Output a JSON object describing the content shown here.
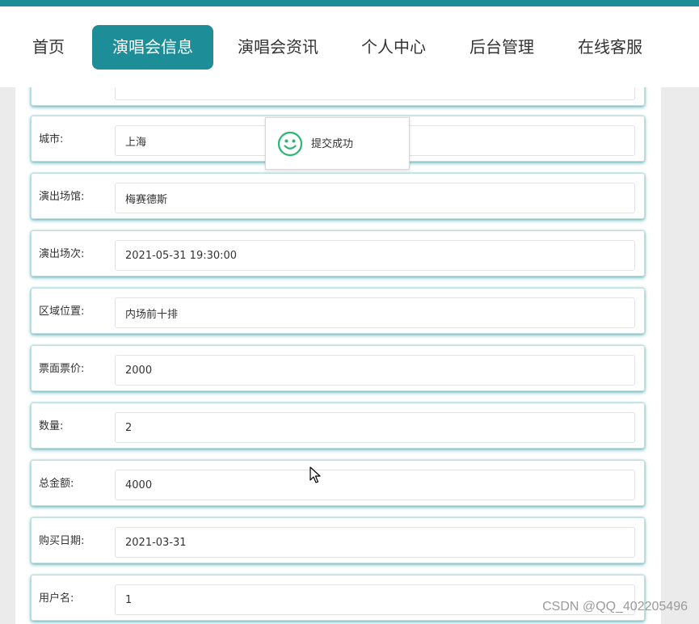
{
  "nav": {
    "items": [
      {
        "label": "首页"
      },
      {
        "label": "演唱会信息",
        "active": true
      },
      {
        "label": "演唱会资讯"
      },
      {
        "label": "个人中心"
      },
      {
        "label": "后台管理"
      },
      {
        "label": "在线客服"
      }
    ]
  },
  "form": {
    "rows": [
      {
        "label": "",
        "value": ""
      },
      {
        "label": "城市:",
        "value": "上海"
      },
      {
        "label": "演出场馆:",
        "value": "梅赛德斯"
      },
      {
        "label": "演出场次:",
        "value": "2021-05-31 19:30:00"
      },
      {
        "label": "区域位置:",
        "value": "内场前十排"
      },
      {
        "label": "票面票价:",
        "value": "2000"
      },
      {
        "label": "数量:",
        "value": "2"
      },
      {
        "label": "总金额:",
        "value": "4000"
      },
      {
        "label": "购买日期:",
        "value": "2021-03-31"
      },
      {
        "label": "用户名:",
        "value": "1"
      }
    ]
  },
  "toast": {
    "message": "提交成功",
    "icon": "smiley-icon"
  },
  "watermark": "CSDN @QQ_402205496",
  "colors": {
    "accent": "#1d8d97"
  }
}
